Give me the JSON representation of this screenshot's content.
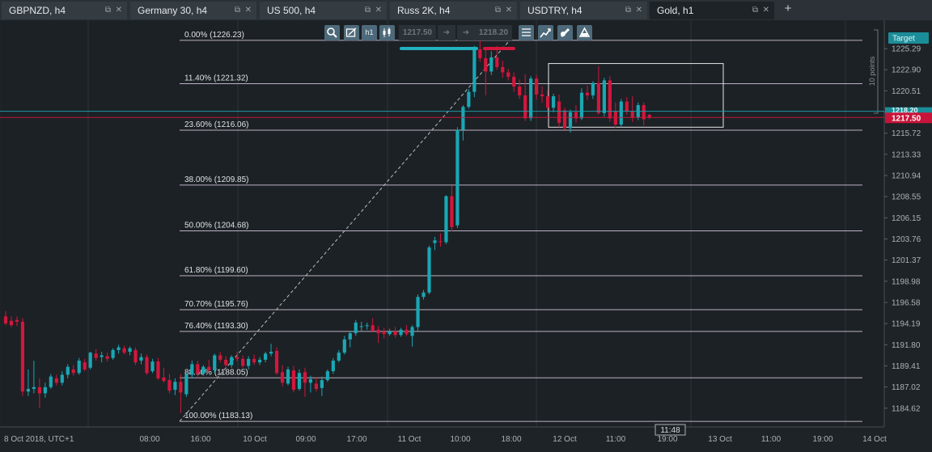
{
  "tabs": [
    {
      "label": "GBPNZD, h4",
      "active": false
    },
    {
      "label": "Germany 30, h4",
      "active": false
    },
    {
      "label": "US 500, h4",
      "active": false
    },
    {
      "label": "Russ 2K, h4",
      "active": false
    },
    {
      "label": "USDTRY, h4",
      "active": false
    },
    {
      "label": "Gold, h1",
      "active": true
    }
  ],
  "tab_controls": {
    "popout": "⧉",
    "close": "✕",
    "add": "+"
  },
  "toolbar": {
    "sell_price": "1217.50",
    "buy_price": "1218.20",
    "sell_arrow": "➜",
    "buy_arrow": "➜",
    "timeframe_label": "h1",
    "icons": [
      "zoom-icon",
      "drawing-tools-icon",
      "timeframe-icon",
      "chart-type-icon",
      "indicators-icon",
      "trade-chart-icon",
      "pencil-icon",
      "template-icon"
    ]
  },
  "colors": {
    "background": "#1e2327",
    "bull": "#1aa7b4",
    "bear": "#d2173d",
    "fib_line": "#d8cbe0",
    "grid": "#2e353b",
    "bid_line": "#d2173d",
    "ask_line": "#1aa7b4"
  },
  "chart_data": {
    "type": "candlestick",
    "symbol": "Gold",
    "timeframe": "h1",
    "ylim": [
      1182.5,
      1228.5
    ],
    "y_ticks": [
      "1225.29",
      "1222.90",
      "1220.51",
      "1218.11",
      "1215.72",
      "1213.33",
      "1210.94",
      "1208.55",
      "1206.15",
      "1203.76",
      "1201.37",
      "1198.98",
      "1196.58",
      "1194.19",
      "1191.80",
      "1189.41",
      "1187.02",
      "1184.62"
    ],
    "x_ticks": [
      "8 Oct 2018, UTC+1",
      "08:00",
      "16:00",
      "10 Oct",
      "09:00",
      "17:00",
      "11 Oct",
      "10:00",
      "18:00",
      "12 Oct",
      "11:00",
      "19:00",
      "13 Oct",
      "11:00",
      "19:00",
      "14 Oct"
    ],
    "crosshair_time": "11:48",
    "bid_price": "1217.50",
    "ask_price": "1218.20",
    "ask_tag_partial": "1218.20",
    "target_label": "Target",
    "range_label": "10 points",
    "fibonacci": [
      {
        "label": "0.00% (1226.23)",
        "price": 1226.23
      },
      {
        "label": "11.40% (1221.32)",
        "price": 1221.32
      },
      {
        "label": "23.60% (1216.06)",
        "price": 1216.06
      },
      {
        "label": "38.00% (1209.85)",
        "price": 1209.85
      },
      {
        "label": "50.00% (1204.68)",
        "price": 1204.68
      },
      {
        "label": "61.80% (1199.60)",
        "price": 1199.6
      },
      {
        "label": "70.70% (1195.76)",
        "price": 1195.76
      },
      {
        "label": "76.40% (1193.30)",
        "price": 1193.3
      },
      {
        "label": "88.60% (1188.05)",
        "price": 1188.05
      },
      {
        "label": "100.00% (1183.13)",
        "price": 1183.13
      }
    ],
    "candles": [
      {
        "o": 1195.0,
        "h": 1195.6,
        "l": 1194.0,
        "c": 1194.2
      },
      {
        "o": 1194.5,
        "h": 1195.0,
        "l": 1193.8,
        "c": 1194.0
      },
      {
        "o": 1194.6,
        "h": 1195.0,
        "l": 1193.9,
        "c": 1194.4
      },
      {
        "o": 1194.4,
        "h": 1194.8,
        "l": 1186.0,
        "c": 1186.5
      },
      {
        "o": 1186.5,
        "h": 1189.0,
        "l": 1186.0,
        "c": 1186.8
      },
      {
        "o": 1186.8,
        "h": 1190.0,
        "l": 1186.3,
        "c": 1187.0
      },
      {
        "o": 1187.0,
        "h": 1188.0,
        "l": 1184.6,
        "c": 1186.3
      },
      {
        "o": 1186.3,
        "h": 1187.5,
        "l": 1185.8,
        "c": 1187.0
      },
      {
        "o": 1187.0,
        "h": 1188.5,
        "l": 1186.8,
        "c": 1188.2
      },
      {
        "o": 1188.0,
        "h": 1188.4,
        "l": 1187.2,
        "c": 1187.5
      },
      {
        "o": 1187.5,
        "h": 1188.8,
        "l": 1187.2,
        "c": 1188.4
      },
      {
        "o": 1188.4,
        "h": 1189.6,
        "l": 1188.0,
        "c": 1189.3
      },
      {
        "o": 1189.0,
        "h": 1189.5,
        "l": 1188.3,
        "c": 1188.6
      },
      {
        "o": 1188.6,
        "h": 1190.3,
        "l": 1188.4,
        "c": 1190.0
      },
      {
        "o": 1189.8,
        "h": 1190.2,
        "l": 1188.8,
        "c": 1189.0
      },
      {
        "o": 1189.2,
        "h": 1191.0,
        "l": 1189.0,
        "c": 1190.9
      },
      {
        "o": 1190.8,
        "h": 1191.3,
        "l": 1190.0,
        "c": 1190.3
      },
      {
        "o": 1190.4,
        "h": 1191.0,
        "l": 1189.8,
        "c": 1190.6
      },
      {
        "o": 1190.5,
        "h": 1190.9,
        "l": 1189.9,
        "c": 1190.2
      },
      {
        "o": 1190.3,
        "h": 1191.4,
        "l": 1190.1,
        "c": 1191.2
      },
      {
        "o": 1191.2,
        "h": 1191.8,
        "l": 1190.8,
        "c": 1191.5
      },
      {
        "o": 1191.4,
        "h": 1191.7,
        "l": 1190.7,
        "c": 1190.9
      },
      {
        "o": 1191.0,
        "h": 1191.6,
        "l": 1190.6,
        "c": 1191.4
      },
      {
        "o": 1191.2,
        "h": 1191.5,
        "l": 1189.5,
        "c": 1189.8
      },
      {
        "o": 1190.0,
        "h": 1190.8,
        "l": 1189.6,
        "c": 1190.4
      },
      {
        "o": 1190.4,
        "h": 1190.7,
        "l": 1188.4,
        "c": 1188.6
      },
      {
        "o": 1188.8,
        "h": 1190.2,
        "l": 1188.6,
        "c": 1189.9
      },
      {
        "o": 1189.9,
        "h": 1190.3,
        "l": 1187.8,
        "c": 1188.0
      },
      {
        "o": 1188.1,
        "h": 1189.2,
        "l": 1187.5,
        "c": 1187.7
      },
      {
        "o": 1187.8,
        "h": 1188.5,
        "l": 1186.3,
        "c": 1186.6
      },
      {
        "o": 1186.7,
        "h": 1188.0,
        "l": 1186.1,
        "c": 1187.6
      },
      {
        "o": 1187.6,
        "h": 1188.5,
        "l": 1184.1,
        "c": 1186.4
      },
      {
        "o": 1186.2,
        "h": 1188.6,
        "l": 1185.9,
        "c": 1188.4
      },
      {
        "o": 1188.4,
        "h": 1190.0,
        "l": 1188.0,
        "c": 1189.6
      },
      {
        "o": 1189.6,
        "h": 1190.0,
        "l": 1188.2,
        "c": 1188.5
      },
      {
        "o": 1188.5,
        "h": 1189.5,
        "l": 1188.3,
        "c": 1189.3
      },
      {
        "o": 1189.3,
        "h": 1190.1,
        "l": 1188.7,
        "c": 1188.9
      },
      {
        "o": 1188.9,
        "h": 1190.8,
        "l": 1188.6,
        "c": 1190.6
      },
      {
        "o": 1190.6,
        "h": 1191.0,
        "l": 1189.8,
        "c": 1190.1
      },
      {
        "o": 1190.1,
        "h": 1190.5,
        "l": 1189.3,
        "c": 1189.5
      },
      {
        "o": 1189.5,
        "h": 1190.6,
        "l": 1189.2,
        "c": 1190.4
      },
      {
        "o": 1190.4,
        "h": 1191.0,
        "l": 1189.9,
        "c": 1190.2
      },
      {
        "o": 1190.2,
        "h": 1190.6,
        "l": 1189.2,
        "c": 1189.4
      },
      {
        "o": 1189.4,
        "h": 1190.5,
        "l": 1189.0,
        "c": 1190.2
      },
      {
        "o": 1190.2,
        "h": 1190.7,
        "l": 1189.5,
        "c": 1189.8
      },
      {
        "o": 1189.8,
        "h": 1190.4,
        "l": 1189.5,
        "c": 1190.1
      },
      {
        "o": 1190.1,
        "h": 1191.0,
        "l": 1189.8,
        "c": 1190.8
      },
      {
        "o": 1190.8,
        "h": 1191.9,
        "l": 1190.5,
        "c": 1191.0
      },
      {
        "o": 1191.1,
        "h": 1191.5,
        "l": 1188.4,
        "c": 1188.6
      },
      {
        "o": 1188.7,
        "h": 1189.5,
        "l": 1187.1,
        "c": 1187.5
      },
      {
        "o": 1187.4,
        "h": 1189.3,
        "l": 1187.2,
        "c": 1189.0
      },
      {
        "o": 1188.9,
        "h": 1189.4,
        "l": 1186.4,
        "c": 1186.7
      },
      {
        "o": 1186.8,
        "h": 1189.0,
        "l": 1186.6,
        "c": 1188.6
      },
      {
        "o": 1188.7,
        "h": 1189.2,
        "l": 1185.9,
        "c": 1187.5
      },
      {
        "o": 1187.5,
        "h": 1188.3,
        "l": 1186.4,
        "c": 1187.9
      },
      {
        "o": 1187.4,
        "h": 1188.1,
        "l": 1186.5,
        "c": 1186.8
      },
      {
        "o": 1186.9,
        "h": 1188.2,
        "l": 1186.0,
        "c": 1187.8
      },
      {
        "o": 1187.8,
        "h": 1189.0,
        "l": 1187.6,
        "c": 1188.8
      },
      {
        "o": 1188.8,
        "h": 1190.3,
        "l": 1188.5,
        "c": 1190.0
      },
      {
        "o": 1190.0,
        "h": 1191.2,
        "l": 1189.8,
        "c": 1190.9
      },
      {
        "o": 1190.9,
        "h": 1192.8,
        "l": 1190.7,
        "c": 1192.4
      },
      {
        "o": 1192.4,
        "h": 1193.3,
        "l": 1191.5,
        "c": 1193.1
      },
      {
        "o": 1193.1,
        "h": 1194.6,
        "l": 1192.8,
        "c": 1194.3
      },
      {
        "o": 1193.8,
        "h": 1194.4,
        "l": 1193.3,
        "c": 1193.9
      },
      {
        "o": 1193.9,
        "h": 1194.3,
        "l": 1193.5,
        "c": 1194.0
      },
      {
        "o": 1194.0,
        "h": 1194.8,
        "l": 1193.2,
        "c": 1193.4
      },
      {
        "o": 1193.5,
        "h": 1193.9,
        "l": 1192.0,
        "c": 1193.1
      },
      {
        "o": 1193.3,
        "h": 1193.7,
        "l": 1192.5,
        "c": 1193.0
      },
      {
        "o": 1193.0,
        "h": 1193.6,
        "l": 1192.8,
        "c": 1193.3
      },
      {
        "o": 1193.3,
        "h": 1193.8,
        "l": 1192.6,
        "c": 1192.9
      },
      {
        "o": 1192.9,
        "h": 1193.7,
        "l": 1192.7,
        "c": 1193.5
      },
      {
        "o": 1193.5,
        "h": 1194.0,
        "l": 1192.8,
        "c": 1193.0
      },
      {
        "o": 1192.8,
        "h": 1194.0,
        "l": 1191.6,
        "c": 1193.8
      },
      {
        "o": 1193.8,
        "h": 1197.5,
        "l": 1193.4,
        "c": 1197.2
      },
      {
        "o": 1197.2,
        "h": 1198.0,
        "l": 1196.9,
        "c": 1197.7
      },
      {
        "o": 1197.7,
        "h": 1203.0,
        "l": 1197.5,
        "c": 1202.8
      },
      {
        "o": 1203.3,
        "h": 1204.0,
        "l": 1202.5,
        "c": 1203.6
      },
      {
        "o": 1203.5,
        "h": 1204.4,
        "l": 1202.9,
        "c": 1203.4
      },
      {
        "o": 1203.4,
        "h": 1208.7,
        "l": 1203.2,
        "c": 1208.6
      },
      {
        "o": 1208.6,
        "h": 1209.8,
        "l": 1204.6,
        "c": 1205.1
      },
      {
        "o": 1205.3,
        "h": 1216.4,
        "l": 1205.0,
        "c": 1216.1
      },
      {
        "o": 1216.1,
        "h": 1218.9,
        "l": 1214.9,
        "c": 1218.7
      },
      {
        "o": 1218.7,
        "h": 1220.7,
        "l": 1218.5,
        "c": 1220.4
      },
      {
        "o": 1220.4,
        "h": 1225.6,
        "l": 1219.8,
        "c": 1225.2
      },
      {
        "o": 1225.2,
        "h": 1226.7,
        "l": 1223.8,
        "c": 1224.2
      },
      {
        "o": 1224.2,
        "h": 1225.3,
        "l": 1220.0,
        "c": 1222.7
      },
      {
        "o": 1222.7,
        "h": 1225.0,
        "l": 1222.3,
        "c": 1224.3
      },
      {
        "o": 1224.3,
        "h": 1225.6,
        "l": 1222.9,
        "c": 1223.2
      },
      {
        "o": 1223.2,
        "h": 1223.9,
        "l": 1222.0,
        "c": 1222.6
      },
      {
        "o": 1222.6,
        "h": 1223.0,
        "l": 1221.7,
        "c": 1222.1
      },
      {
        "o": 1222.1,
        "h": 1222.6,
        "l": 1220.4,
        "c": 1221.0
      },
      {
        "o": 1221.0,
        "h": 1221.8,
        "l": 1219.6,
        "c": 1220.0
      },
      {
        "o": 1220.0,
        "h": 1222.4,
        "l": 1217.1,
        "c": 1217.4
      },
      {
        "o": 1217.4,
        "h": 1222.2,
        "l": 1217.1,
        "c": 1221.9
      },
      {
        "o": 1221.9,
        "h": 1222.3,
        "l": 1219.5,
        "c": 1220.1
      },
      {
        "o": 1220.1,
        "h": 1221.0,
        "l": 1219.2,
        "c": 1219.9
      },
      {
        "o": 1219.9,
        "h": 1220.6,
        "l": 1218.2,
        "c": 1218.6
      },
      {
        "o": 1218.6,
        "h": 1220.2,
        "l": 1218.1,
        "c": 1219.9
      },
      {
        "o": 1219.3,
        "h": 1220.1,
        "l": 1216.4,
        "c": 1216.9
      },
      {
        "o": 1218.3,
        "h": 1218.6,
        "l": 1216.1,
        "c": 1216.3
      },
      {
        "o": 1216.3,
        "h": 1218.4,
        "l": 1215.8,
        "c": 1218.1
      },
      {
        "o": 1218.1,
        "h": 1218.9,
        "l": 1216.9,
        "c": 1217.4
      },
      {
        "o": 1217.4,
        "h": 1220.8,
        "l": 1217.2,
        "c": 1220.3
      },
      {
        "o": 1220.3,
        "h": 1221.1,
        "l": 1219.5,
        "c": 1220.0
      },
      {
        "o": 1220.0,
        "h": 1221.6,
        "l": 1219.6,
        "c": 1221.4
      },
      {
        "o": 1221.4,
        "h": 1223.3,
        "l": 1217.8,
        "c": 1218.0
      },
      {
        "o": 1218.0,
        "h": 1222.0,
        "l": 1217.6,
        "c": 1221.7
      },
      {
        "o": 1221.7,
        "h": 1222.2,
        "l": 1217.0,
        "c": 1217.4
      },
      {
        "o": 1218.2,
        "h": 1219.2,
        "l": 1216.3,
        "c": 1216.7
      },
      {
        "o": 1216.7,
        "h": 1219.6,
        "l": 1216.4,
        "c": 1219.3
      },
      {
        "o": 1219.3,
        "h": 1219.8,
        "l": 1217.8,
        "c": 1218.2
      },
      {
        "o": 1218.2,
        "h": 1219.9,
        "l": 1217.0,
        "c": 1217.5
      },
      {
        "o": 1217.5,
        "h": 1219.2,
        "l": 1217.2,
        "c": 1218.9
      },
      {
        "o": 1218.9,
        "h": 1219.2,
        "l": 1216.6,
        "c": 1217.3
      },
      {
        "o": 1217.8,
        "h": 1217.9,
        "l": 1217.3,
        "c": 1217.5
      }
    ]
  }
}
